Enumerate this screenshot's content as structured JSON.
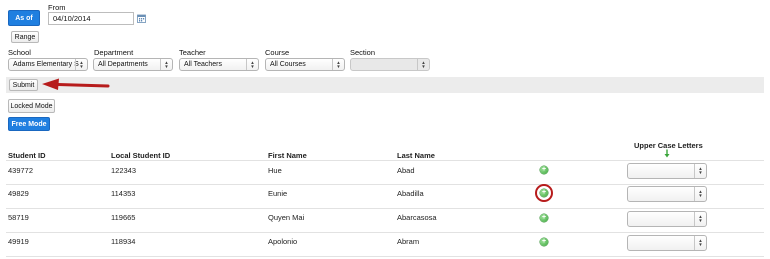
{
  "mode_buttons": {
    "as_of": "As of",
    "range": "Range"
  },
  "date": {
    "label": "From",
    "value": "04/10/2014"
  },
  "filters": [
    {
      "label": "School",
      "value": "Adams Elementary S"
    },
    {
      "label": "Department",
      "value": "All Departments"
    },
    {
      "label": "Teacher",
      "value": "All Teachers"
    },
    {
      "label": "Course",
      "value": "All Courses"
    },
    {
      "label": "Section",
      "value": ""
    }
  ],
  "submit_label": "Submit",
  "lock_modes": {
    "locked": "Locked Mode",
    "free": "Free Mode"
  },
  "table": {
    "headers": {
      "student_id": "Student ID",
      "local_student_id": "Local Student ID",
      "first_name": "First Name",
      "last_name": "Last Name",
      "upper_case_letters": "Upper Case Letters"
    },
    "rows": [
      {
        "student_id": "439772",
        "local_student_id": "122343",
        "first_name": "Hue",
        "last_name": "Abad"
      },
      {
        "student_id": "49829",
        "local_student_id": "114353",
        "first_name": "Eunie",
        "last_name": "Abadilla"
      },
      {
        "student_id": "58719",
        "local_student_id": "119665",
        "first_name": "Quyen Mai",
        "last_name": "Abarcasosa"
      },
      {
        "student_id": "49919",
        "local_student_id": "118934",
        "first_name": "Apolonio",
        "last_name": "Abram"
      }
    ]
  },
  "icons": {
    "calendar": "calendar-icon",
    "add": "plus-circle-icon",
    "sort": "down-arrow-icon",
    "annotation": "red-arrow-icon"
  },
  "colors": {
    "primary_button": "#1f7fe0",
    "add_icon": "#3aa53a",
    "annotation": "#b71c1c",
    "sort_arrow": "#3aa53a"
  }
}
